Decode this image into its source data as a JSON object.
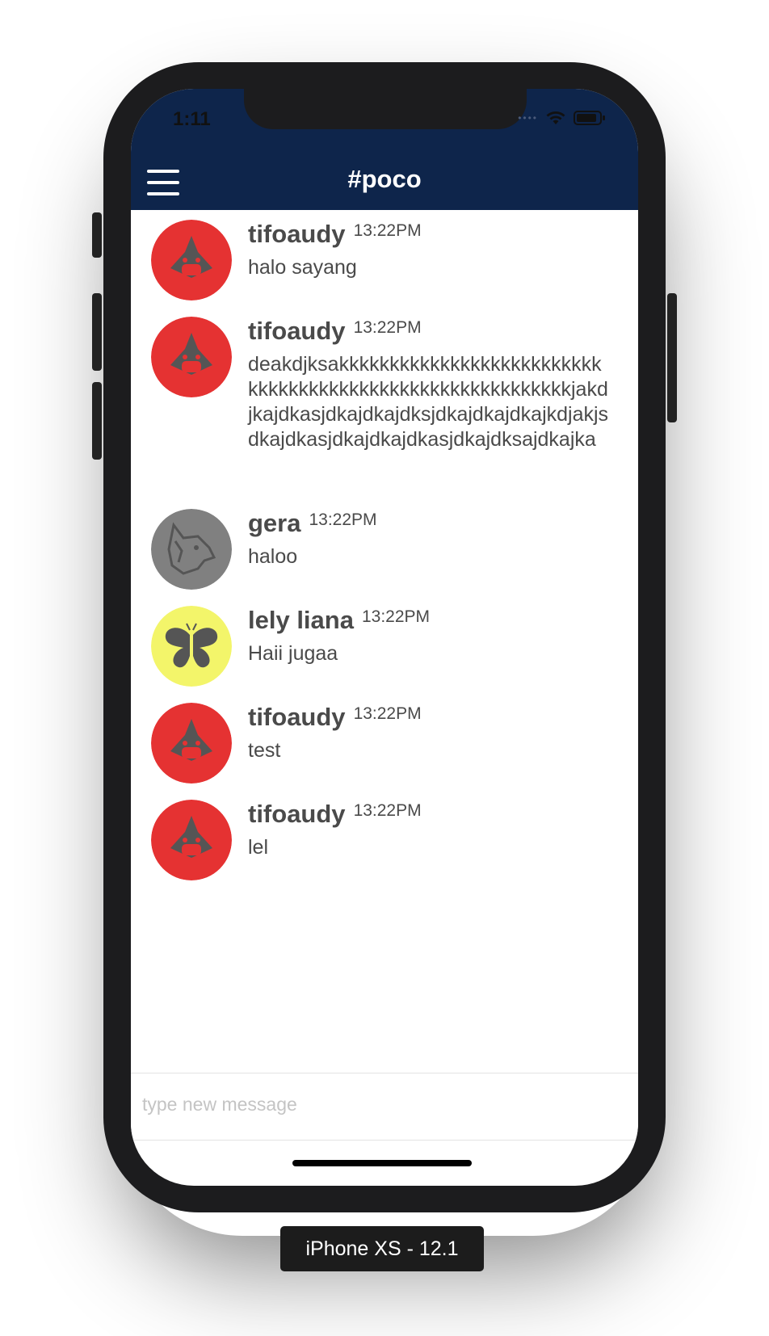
{
  "device": {
    "label": "iPhone XS - 12.1"
  },
  "status_bar": {
    "time": "1:11",
    "wifi_icon": "wifi-icon",
    "battery_icon": "battery-icon"
  },
  "header": {
    "title": "#poco",
    "menu_icon": "hamburger-menu-icon",
    "background": "#0e254b"
  },
  "messages": [
    {
      "user": "tifoaudy",
      "time": "13:22PM",
      "text": "halo sayang",
      "avatar": "shark-icon",
      "avatar_color": "#e53232"
    },
    {
      "user": "tifoaudy",
      "time": "13:22PM",
      "text": "deakdjksakkkkkkkkkkkkkkkkkkkkkkkkkkkkkkkkkkkkkkkkkkkkkkkkkkkkkkkkkkjakdjkajdkasjdkajdkajdksjdkajdkajdkajkdjakjsdkajdkasjdkajdkajdkasjdkajdksajdkajka",
      "avatar": "shark-icon",
      "avatar_color": "#e53232"
    },
    {
      "user": "gera",
      "time": "13:22PM",
      "text": "haloo",
      "avatar": "wolf-icon",
      "avatar_color": "#808080"
    },
    {
      "user": "lely liana",
      "time": "13:22PM",
      "text": "Haii jugaa",
      "avatar": "butterfly-icon",
      "avatar_color": "#f3f56a"
    },
    {
      "user": "tifoaudy",
      "time": "13:22PM",
      "text": "test",
      "avatar": "shark-icon",
      "avatar_color": "#e53232"
    },
    {
      "user": "tifoaudy",
      "time": "13:22PM",
      "text": "lel",
      "avatar": "shark-icon",
      "avatar_color": "#e53232"
    }
  ],
  "composer": {
    "placeholder": "type new message",
    "value": ""
  }
}
